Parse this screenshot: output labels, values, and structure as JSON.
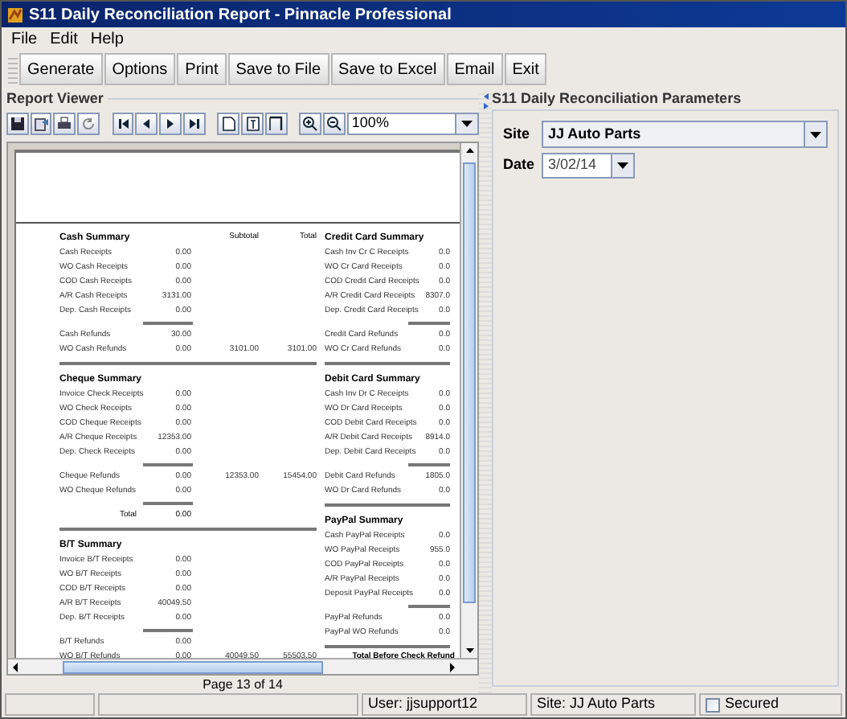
{
  "window": {
    "title": "S11 Daily Reconciliation Report - Pinnacle Professional"
  },
  "menu": [
    "File",
    "Edit",
    "Help"
  ],
  "toolbar": [
    "Generate",
    "Options",
    "Print",
    "Save to File",
    "Save to Excel",
    "Email",
    "Exit"
  ],
  "viewer": {
    "title": "Report Viewer",
    "zoom": "100%",
    "page_label": "Page 13 of 14",
    "left_sections": [
      {
        "title": "Cash Summary",
        "columns": {
          "subtotal": "Subtotal",
          "total": "Total"
        },
        "rows": [
          {
            "label": "Cash Receipts",
            "value": "0.00"
          },
          {
            "label": "WO Cash Receipts",
            "value": "0.00"
          },
          {
            "label": "COD Cash Receipts",
            "value": "0.00"
          },
          {
            "label": "A/R Cash Receipts",
            "value": "3131.00"
          },
          {
            "label": "Dep. Cash Receipts",
            "value": "0.00"
          }
        ],
        "refunds": [
          {
            "label": "Cash Refunds",
            "value": "30.00"
          },
          {
            "label": "WO Cash Refunds",
            "value": "0.00",
            "subtotal": "3101.00",
            "total": "3101.00"
          }
        ]
      },
      {
        "title": "Cheque Summary",
        "rows": [
          {
            "label": "Invoice Check Receipts",
            "value": "0.00"
          },
          {
            "label": "WO Check Receipts",
            "value": "0.00"
          },
          {
            "label": "COD Cheque Receipts",
            "value": "0.00"
          },
          {
            "label": "A/R Cheque Receipts",
            "value": "12353.00"
          },
          {
            "label": "Dep. Check Receipts",
            "value": "0.00"
          }
        ],
        "refunds": [
          {
            "label": "Cheque Refunds",
            "value": "0.00",
            "subtotal": "12353.00",
            "total": "15454.00"
          },
          {
            "label": "WO Cheque Refunds",
            "value": "0.00"
          }
        ],
        "sum": {
          "label": "Total",
          "value": "0.00"
        }
      },
      {
        "title": "B/T Summary",
        "rows": [
          {
            "label": "Invoice B/T Receipts",
            "value": "0.00"
          },
          {
            "label": "WO B/T Receipts",
            "value": "0.00"
          },
          {
            "label": "COD B/T Receipts",
            "value": "0.00"
          },
          {
            "label": "A/R B/T Receipts",
            "value": "40049.50"
          },
          {
            "label": "Dep. B/T Receipts",
            "value": "0.00"
          }
        ],
        "refunds": [
          {
            "label": "B/T Refunds",
            "value": "0.00"
          },
          {
            "label": "WO B/T Refunds",
            "value": "0.00",
            "subtotal": "40049.50",
            "total": "55503.50"
          }
        ]
      }
    ],
    "right_sections": [
      {
        "title": "Credit Card Summary",
        "rows": [
          {
            "label": "Cash Inv Cr C Receipts",
            "value": "0.0"
          },
          {
            "label": "WO Cr Card Receipts",
            "value": "0.0"
          },
          {
            "label": "COD Credit Card Receipts",
            "value": "0.0"
          },
          {
            "label": "A/R Credit Card Receipts",
            "value": "8307.0"
          },
          {
            "label": "Dep. Credit Card Receipts",
            "value": "0.0"
          }
        ],
        "refunds": [
          {
            "label": "Credit Card Refunds",
            "value": "0.0"
          },
          {
            "label": "WO Cr Card Refunds",
            "value": "0.0"
          }
        ]
      },
      {
        "title": "Debit Card Summary",
        "rows": [
          {
            "label": "Cash Inv Dr C Receipts",
            "value": "0.0"
          },
          {
            "label": "WO Dr Card Receipts",
            "value": "0.0"
          },
          {
            "label": "COD Debit Card Receipts",
            "value": "0.0"
          },
          {
            "label": "A/R Debit Card Receipts",
            "value": "8914.0"
          },
          {
            "label": "Dep. Debit Card Receipts",
            "value": "0.0"
          }
        ],
        "refunds": [
          {
            "label": "Debit Card Refunds",
            "value": "1805.0"
          },
          {
            "label": "WO Dr Card Refunds",
            "value": "0.0"
          }
        ]
      },
      {
        "title": "PayPal Summary",
        "rows": [
          {
            "label": "Cash PayPal Receipts",
            "value": "0.0"
          },
          {
            "label": "WO PayPal Receipts",
            "value": "955.0"
          },
          {
            "label": "COD PayPal Receipts",
            "value": "0.0"
          },
          {
            "label": "A/R PayPal Receipts",
            "value": "0.0"
          },
          {
            "label": "Deposit PayPal Receipts",
            "value": "0.0"
          }
        ],
        "refunds": [
          {
            "label": "PayPal Refunds",
            "value": "0.0"
          },
          {
            "label": "PayPal WO Refunds",
            "value": "0.0"
          }
        ]
      }
    ],
    "grand_total_label": "Total Before Check Refund"
  },
  "parameters": {
    "title": "S11 Daily Reconciliation Parameters",
    "site_label": "Site",
    "site": "JJ Auto Parts",
    "date_label": "Date",
    "date": "3/02/14"
  },
  "status_bar": {
    "user": "User: jjsupport12",
    "site": "Site: JJ Auto Parts",
    "secured_label": "Secured",
    "secured": false
  }
}
